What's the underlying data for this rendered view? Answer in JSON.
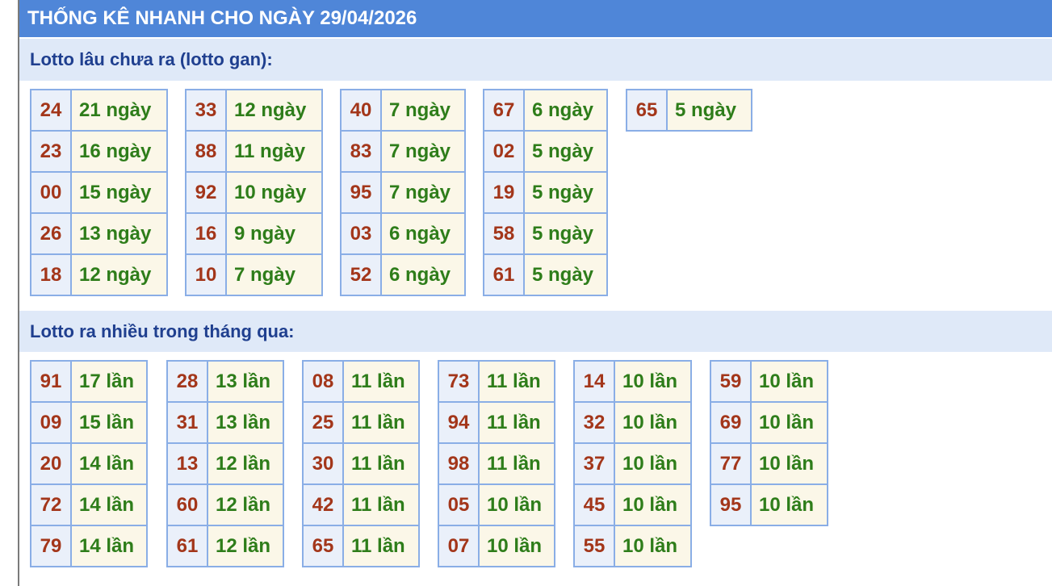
{
  "title": "THỐNG KÊ NHANH CHO NGÀY 29/04/2026",
  "gan": {
    "heading": "Lotto lâu chưa ra (lotto gan):",
    "groups": [
      [
        {
          "num": "24",
          "val": "21 ngày"
        },
        {
          "num": "23",
          "val": "16 ngày"
        },
        {
          "num": "00",
          "val": "15 ngày"
        },
        {
          "num": "26",
          "val": "13 ngày"
        },
        {
          "num": "18",
          "val": "12 ngày"
        }
      ],
      [
        {
          "num": "33",
          "val": "12 ngày"
        },
        {
          "num": "88",
          "val": "11 ngày"
        },
        {
          "num": "92",
          "val": "10 ngày"
        },
        {
          "num": "16",
          "val": "9 ngày"
        },
        {
          "num": "10",
          "val": "7 ngày"
        }
      ],
      [
        {
          "num": "40",
          "val": "7 ngày"
        },
        {
          "num": "83",
          "val": "7 ngày"
        },
        {
          "num": "95",
          "val": "7 ngày"
        },
        {
          "num": "03",
          "val": "6 ngày"
        },
        {
          "num": "52",
          "val": "6 ngày"
        }
      ],
      [
        {
          "num": "67",
          "val": "6 ngày"
        },
        {
          "num": "02",
          "val": "5 ngày"
        },
        {
          "num": "19",
          "val": "5 ngày"
        },
        {
          "num": "58",
          "val": "5 ngày"
        },
        {
          "num": "61",
          "val": "5 ngày"
        }
      ],
      [
        {
          "num": "65",
          "val": "5 ngày"
        }
      ]
    ]
  },
  "frequent": {
    "heading": "Lotto ra nhiều trong tháng qua:",
    "groups": [
      [
        {
          "num": "91",
          "val": "17 lần"
        },
        {
          "num": "09",
          "val": "15 lần"
        },
        {
          "num": "20",
          "val": "14 lần"
        },
        {
          "num": "72",
          "val": "14 lần"
        },
        {
          "num": "79",
          "val": "14 lần"
        }
      ],
      [
        {
          "num": "28",
          "val": "13 lần"
        },
        {
          "num": "31",
          "val": "13 lần"
        },
        {
          "num": "13",
          "val": "12 lần"
        },
        {
          "num": "60",
          "val": "12 lần"
        },
        {
          "num": "61",
          "val": "12 lần"
        }
      ],
      [
        {
          "num": "08",
          "val": "11 lần"
        },
        {
          "num": "25",
          "val": "11 lần"
        },
        {
          "num": "30",
          "val": "11 lần"
        },
        {
          "num": "42",
          "val": "11 lần"
        },
        {
          "num": "65",
          "val": "11 lần"
        }
      ],
      [
        {
          "num": "73",
          "val": "11 lần"
        },
        {
          "num": "94",
          "val": "11 lần"
        },
        {
          "num": "98",
          "val": "11 lần"
        },
        {
          "num": "05",
          "val": "10 lần"
        },
        {
          "num": "07",
          "val": "10 lần"
        }
      ],
      [
        {
          "num": "14",
          "val": "10 lần"
        },
        {
          "num": "32",
          "val": "10 lần"
        },
        {
          "num": "37",
          "val": "10 lần"
        },
        {
          "num": "45",
          "val": "10 lần"
        },
        {
          "num": "55",
          "val": "10 lần"
        }
      ],
      [
        {
          "num": "59",
          "val": "10 lần"
        },
        {
          "num": "69",
          "val": "10 lần"
        },
        {
          "num": "77",
          "val": "10 lần"
        },
        {
          "num": "95",
          "val": "10 lần"
        }
      ]
    ]
  }
}
